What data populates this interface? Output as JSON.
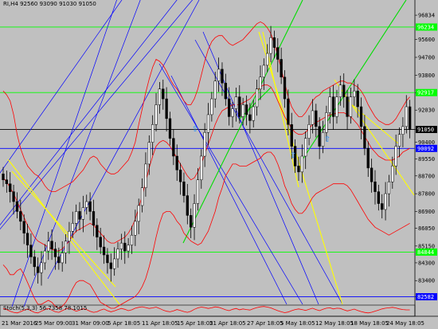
{
  "header": {
    "symbol_info": "RI,H4  92560 93090 91030 91050",
    "oscillator_info": "Stoch(5,3,3) 56.7358 78.1015"
  },
  "colors": {
    "background": "#c0c0c0",
    "candle": "#000000",
    "bands": "#ff0000",
    "fan_lines": "#0000ff",
    "yellow_lines": "#ffff00",
    "green_lines": "#00dd00",
    "hline_blue": "#0000ff",
    "hline_green": "#00ff00",
    "arrow": "#1e90ff"
  },
  "chart_data": {
    "type": "candlestick",
    "y_range": [
      82200,
      97200
    ],
    "price_ticks": [
      96834,
      95600,
      94700,
      93800,
      92915,
      92030,
      91050,
      90400,
      89550,
      88700,
      87800,
      86900,
      86050,
      85150,
      84300,
      83400,
      82582
    ],
    "price_tick_labels": [
      "96834",
      "95600",
      "94700",
      "93800",
      "92915",
      "92030",
      "91050",
      "90400",
      "89550",
      "88700",
      "87800",
      "86900",
      "86050",
      "85150",
      "84300",
      "83400",
      "82582"
    ],
    "date_labels": [
      "21 Mar 2016",
      "25 Mar 09:00",
      "31 Mar 09:00",
      "5 Apr 18:05",
      "11 Apr 18:05",
      "15 Apr 18:05",
      "21 Apr 18:05",
      "27 Apr 18:05",
      "5 May 18:05",
      "12 May 18:05",
      "18 May 18:05",
      "24 May 18:05"
    ],
    "marked_levels": [
      {
        "price": 96234,
        "label": "96234",
        "color": "#00ff00"
      },
      {
        "price": 92917,
        "label": "92917",
        "color": "#00ff00"
      },
      {
        "price": 91050,
        "label": "91050",
        "color": "#000000"
      },
      {
        "price": 90092,
        "label": "90092",
        "color": "#0000ff"
      },
      {
        "price": 84844,
        "label": "84844",
        "color": "#00ff00"
      },
      {
        "price": 82582,
        "label": "82582",
        "color": "#0000ff"
      }
    ],
    "closes": [
      88500,
      88300,
      87900,
      87400,
      86900,
      86400,
      85800,
      85200,
      84600,
      84100,
      83800,
      84300,
      84900,
      85400,
      85000,
      84600,
      84300,
      84800,
      85400,
      85900,
      86300,
      86900,
      86500,
      87100,
      87400,
      86900,
      86200,
      85600,
      85100,
      84700,
      84300,
      84000,
      84500,
      85000,
      85300,
      84900,
      85200,
      85700,
      86400,
      87200,
      88100,
      89300,
      90400,
      91300,
      92300,
      93100,
      92600,
      91600,
      90600,
      89700,
      89000,
      88400,
      87700,
      86700,
      86100,
      87300,
      88500,
      89700,
      90900,
      91800,
      92600,
      93500,
      94100,
      93400,
      92600,
      91700,
      92100,
      92700,
      91700,
      92300,
      91800,
      91500,
      92200,
      93100,
      93700,
      94300,
      94900,
      95700,
      95200,
      94600,
      93700,
      92600,
      91300,
      90200,
      89200,
      88900,
      89700,
      90600,
      91300,
      92000,
      91200,
      90200,
      90900,
      91900,
      92700,
      91700,
      92700,
      93300,
      92700,
      91700,
      92700,
      93000,
      92200,
      91200,
      90100,
      89100,
      88400,
      87900,
      87300,
      87000,
      87800,
      88400,
      89200,
      90200,
      90800,
      91200,
      92200,
      91050
    ],
    "bollinger_upper": [
      93000,
      92800,
      92500,
      91800,
      90800,
      90100,
      89600,
      89200,
      89000,
      88800,
      88700,
      88500,
      88200,
      88000,
      87900,
      87900,
      88000,
      88100,
      88200,
      88300,
      88400,
      88600,
      88800,
      89000,
      89300,
      89600,
      89700,
      89600,
      89300,
      89100,
      88900,
      88800,
      88800,
      88900,
      89100,
      89300,
      89500,
      89900,
      90400,
      91300,
      92100,
      92900,
      93600,
      94200,
      94600,
      94500,
      94300,
      94000,
      93600,
      93300,
      93100,
      92800,
      92500,
      92300,
      92300,
      92600,
      93100,
      93800,
      94500,
      95100,
      95500,
      95700,
      95800,
      95800,
      95600,
      95400,
      95300,
      95400,
      95500,
      95600,
      95800,
      96000,
      96200,
      96400,
      96500,
      96400,
      96200,
      95900,
      95400,
      94800,
      94100,
      93400,
      92700,
      92200,
      91900,
      91700,
      91700,
      91900,
      92200,
      92500,
      92700,
      92800,
      93000,
      93100,
      93200,
      93300,
      93400,
      93500,
      93500,
      93400,
      93400,
      93300,
      93200,
      93000,
      92700,
      92300,
      92000,
      91700,
      91500,
      91400,
      91300,
      91300,
      91400,
      91600,
      91900,
      92200,
      92500,
      92700
    ],
    "bollinger_mid": [
      88600,
      88400,
      88100,
      87800,
      87400,
      87000,
      86600,
      86200,
      85900,
      85600,
      85400,
      85300,
      85200,
      85100,
      85000,
      84900,
      84900,
      85000,
      85200,
      85400,
      85700,
      85900,
      86000,
      86100,
      86200,
      86300,
      86200,
      86000,
      85800,
      85600,
      85400,
      85300,
      85300,
      85400,
      85500,
      85600,
      85800,
      86100,
      86500,
      87100,
      87700,
      88400,
      89100,
      89700,
      90200,
      90400,
      90500,
      90400,
      90200,
      89900,
      89600,
      89300,
      89000,
      88700,
      88500,
      88600,
      88900,
      89300,
      89800,
      90300,
      90800,
      91300,
      91700,
      92000,
      92100,
      92200,
      92300,
      92300,
      92300,
      92400,
      92500,
      92600,
      92800,
      93000,
      93200,
      93300,
      93300,
      93200,
      92900,
      92500,
      92100,
      91700,
      91400,
      91100,
      90900,
      90800,
      90800,
      90900,
      91100,
      91300,
      91400,
      91500,
      91600,
      91700,
      91800,
      91800,
      91900,
      91900,
      91900,
      91800,
      91700,
      91500,
      91300,
      91000,
      90700,
      90400,
      90100,
      89900,
      89700,
      89600,
      89500,
      89500,
      89500,
      89600,
      89700,
      89900,
      90000,
      90100
    ],
    "bollinger_lower": [
      84200,
      84000,
      83700,
      83700,
      83900,
      84000,
      83700,
      83300,
      82900,
      82500,
      82200,
      82200,
      82300,
      82400,
      82300,
      82100,
      82000,
      82100,
      82300,
      82600,
      83000,
      83300,
      83400,
      83400,
      83300,
      83200,
      82900,
      82600,
      82300,
      82200,
      82100,
      82000,
      82000,
      82100,
      82200,
      82300,
      82400,
      82500,
      82600,
      82800,
      83100,
      83500,
      84100,
      84800,
      85600,
      86300,
      86800,
      86900,
      86900,
      86700,
      86400,
      86200,
      85800,
      85600,
      85400,
      85300,
      85200,
      85300,
      85600,
      85900,
      86400,
      86900,
      87600,
      88100,
      88700,
      89000,
      89300,
      89300,
      89200,
      89200,
      89200,
      89300,
      89400,
      89500,
      89600,
      89800,
      89900,
      89900,
      89700,
      89300,
      88800,
      88200,
      87800,
      87300,
      87000,
      86800,
      86800,
      87000,
      87300,
      87600,
      87800,
      87900,
      88000,
      88100,
      88200,
      88300,
      88300,
      88300,
      88300,
      88200,
      88000,
      87700,
      87400,
      87100,
      86800,
      86500,
      86300,
      86100,
      86000,
      85900,
      85800,
      85700,
      85800,
      85900,
      86000,
      86100,
      86200,
      86300
    ],
    "stochastic": [
      70,
      60,
      45,
      35,
      30,
      40,
      55,
      65,
      50,
      35,
      30,
      45,
      60,
      70,
      55,
      40,
      35,
      50,
      65,
      75,
      60,
      45,
      55,
      68,
      60,
      45,
      35,
      40,
      55,
      65,
      50,
      40,
      48,
      60,
      70,
      62,
      50,
      58,
      72,
      80,
      85,
      78,
      70,
      75,
      82,
      70,
      55,
      45,
      40,
      48,
      60,
      52,
      42,
      35,
      45,
      62,
      75,
      82,
      78,
      70,
      76,
      84,
      80,
      70,
      58,
      50,
      62,
      70,
      58,
      66,
      60,
      56,
      68,
      78,
      84,
      88,
      82,
      75,
      62,
      50,
      40,
      32,
      38,
      50,
      60,
      66,
      60,
      52,
      62,
      72,
      60,
      50,
      62,
      72,
      76,
      66,
      72,
      70,
      58,
      48,
      56,
      64,
      52,
      42,
      34,
      30,
      36,
      46,
      56,
      66,
      72,
      76,
      80,
      74,
      66,
      60,
      57,
      57
    ]
  }
}
